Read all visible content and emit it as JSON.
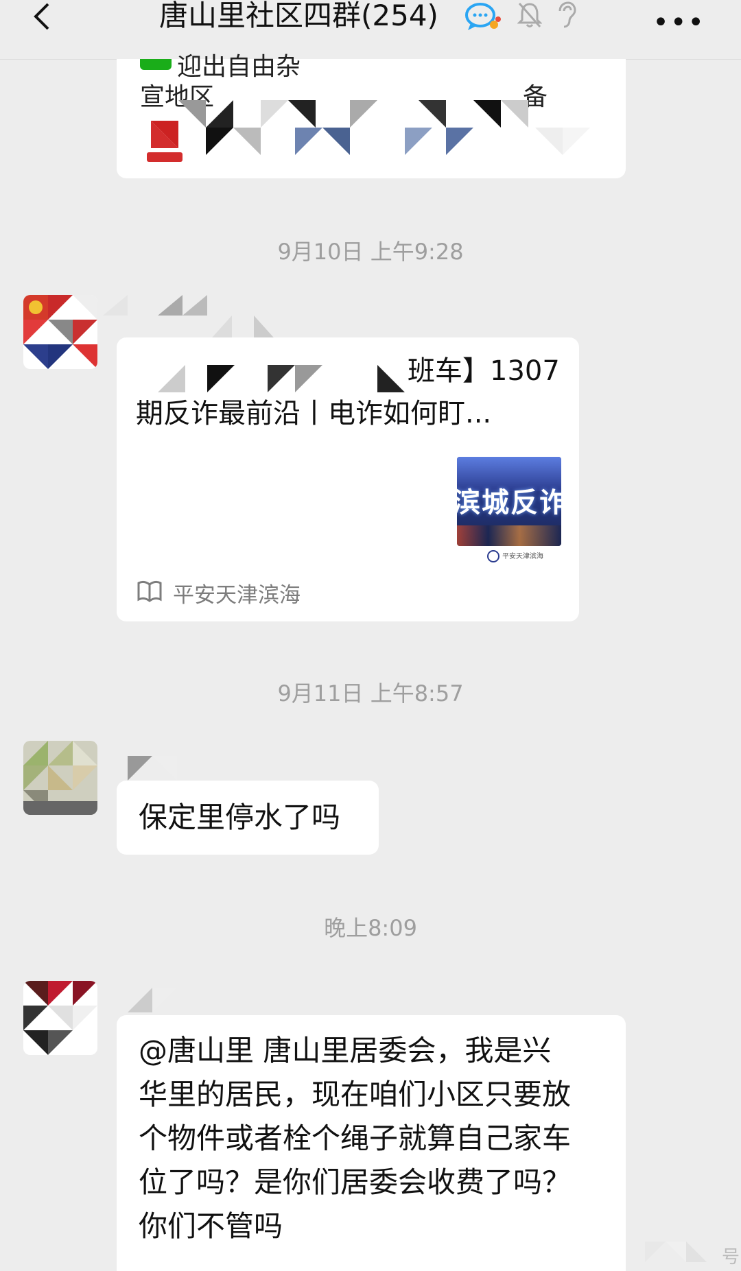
{
  "header": {
    "title": "唐山里社区四群(254)"
  },
  "messages": {
    "card1": {
      "partial_line1": "迎出自由杂",
      "partial_line2": "宣地区",
      "partial_end": "备"
    },
    "time1": "9月10日 上午9:28",
    "card2": {
      "title_line1": "】1307",
      "title_prefix_fragment": "班车",
      "title_line2": "期反诈最前沿丨电诈如何盯...",
      "thumb_text": "滨城反诈",
      "thumb_footer": "平安天津滨海",
      "source": "平安天津滨海"
    },
    "time2": "9月11日 上午8:57",
    "msg3": "保定里停水了吗",
    "time3": "晚上8:09",
    "msg4": {
      "lines": [
        "@唐山里  唐山里居委会，我是兴",
        "华里的居民，现在咱们小区只要放",
        "个物件或者栓个绳子就算自己家车",
        "位了吗？是你们居委会收费了吗？",
        "你们不管吗"
      ]
    },
    "watermark_fragment": "号"
  },
  "colors": {
    "background": "#ededed",
    "bubble": "#ffffff",
    "time_text": "#9e9e9e",
    "source_text": "#7d7d7d"
  }
}
